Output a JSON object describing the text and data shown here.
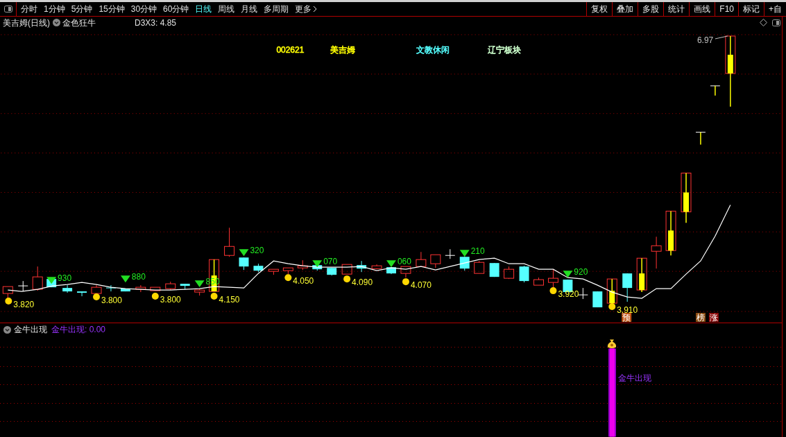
{
  "toolbar": {
    "periods": [
      {
        "label": "分时",
        "selected": false
      },
      {
        "label": "1分钟",
        "selected": false
      },
      {
        "label": "5分钟",
        "selected": false
      },
      {
        "label": "15分钟",
        "selected": false
      },
      {
        "label": "30分钟",
        "selected": false
      },
      {
        "label": "60分钟",
        "selected": false
      },
      {
        "label": "日线",
        "selected": true
      },
      {
        "label": "周线",
        "selected": false
      },
      {
        "label": "月线",
        "selected": false
      },
      {
        "label": "多周期",
        "selected": false
      }
    ],
    "more": "更多",
    "tools": [
      "复权",
      "叠加",
      "多股",
      "统计",
      "画线",
      "F10",
      "标记",
      "+自"
    ]
  },
  "title_bar": {
    "stock": "美吉姆(日线)",
    "indicator": "金色狂牛",
    "reading": "D3X3: 4.85"
  },
  "chart": {
    "info": [
      {
        "text": "002621",
        "color": "#ffff00"
      },
      {
        "text": "美吉姆",
        "color": "#ffff00"
      },
      {
        "text": "文教休闲",
        "color": "#55ffff"
      },
      {
        "text": "辽宁板块",
        "color": "#ccffcc"
      }
    ],
    "high_label": "6.97",
    "sell_marks": [
      "930",
      "880",
      "850",
      "320",
      "070",
      "060",
      "210",
      "920"
    ],
    "buy_marks": [
      "3.820",
      "3.800",
      "3.800",
      "4.150",
      "4.050",
      "4.090",
      "4.070",
      "3.920",
      "3.910"
    ],
    "badges": [
      {
        "text": "预",
        "color": "#c05010"
      },
      {
        "text": "榜",
        "color": "#8b4a10"
      },
      {
        "text": "涨",
        "color": "#8b0a0a"
      }
    ]
  },
  "indicator": {
    "title": "金牛出现",
    "reading": "金牛出现: 0.00",
    "signal_label": "金牛出现"
  }
}
